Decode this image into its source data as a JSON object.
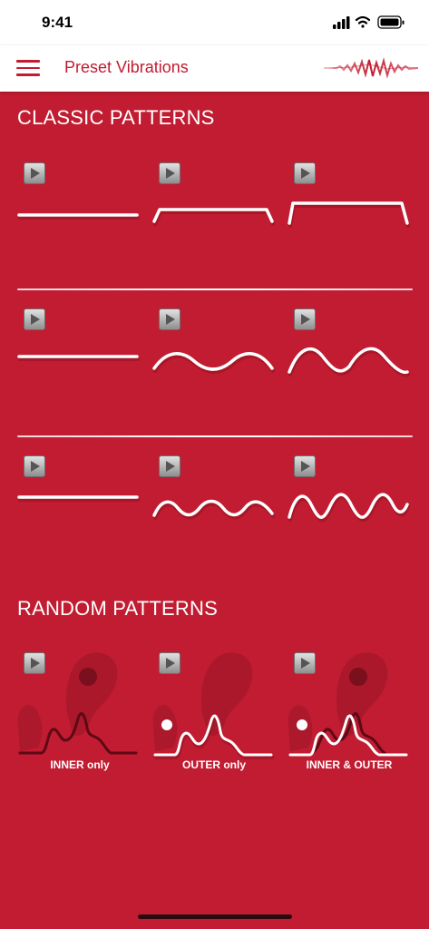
{
  "status": {
    "time": "9:41",
    "icons": [
      "signal-icon",
      "wifi-icon",
      "battery-icon"
    ]
  },
  "header": {
    "title": "Preset Vibrations",
    "menu_icon": "hamburger-menu-icon",
    "brand_icon": "waveform-logo-icon"
  },
  "sections": {
    "classic": {
      "title": "CLASSIC PATTERNS"
    },
    "random": {
      "title": "RANDOM PATTERNS"
    }
  },
  "classic_patterns": [
    {
      "row": 1,
      "items": [
        "flat",
        "trapezoid-low",
        "trapezoid-high"
      ]
    },
    {
      "row": 2,
      "items": [
        "flat",
        "wave-low",
        "wave-high"
      ]
    },
    {
      "row": 3,
      "items": [
        "flat",
        "wave-fast-low",
        "wave-fast-high"
      ]
    }
  ],
  "random_patterns": [
    {
      "label": "INNER only"
    },
    {
      "label": "OUTER only"
    },
    {
      "label": "INNER & OUTER"
    }
  ],
  "colors": {
    "background": "#c11c31",
    "accent": "#c11c31",
    "line": "#ffffff",
    "silhouette": "#a8182b",
    "dot_dark": "#7a0f1d"
  }
}
